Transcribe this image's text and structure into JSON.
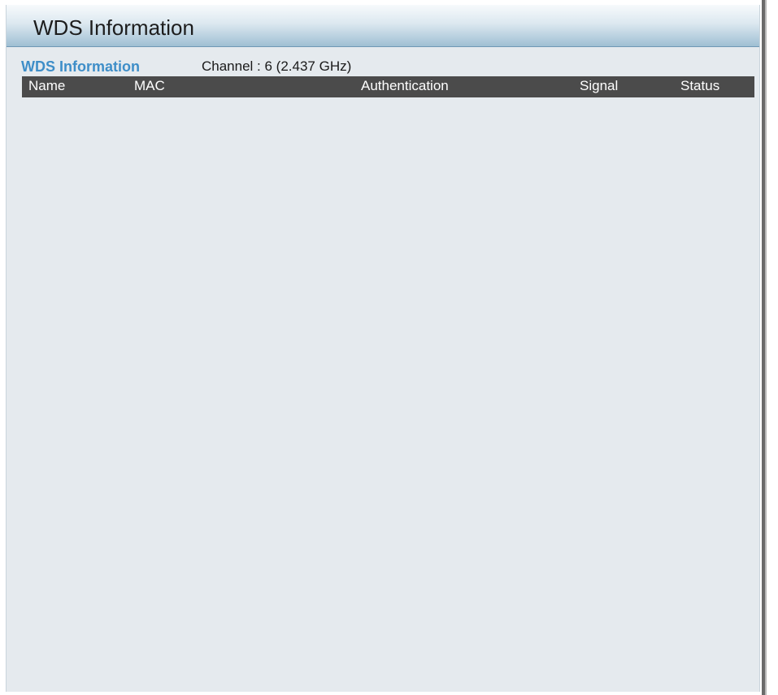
{
  "panel": {
    "title": "WDS Information"
  },
  "section": {
    "label": "WDS Information",
    "channel": "Channel : 6 (2.437 GHz)"
  },
  "table": {
    "columns": [
      "Name",
      "MAC",
      "Authentication",
      "Signal",
      "Status"
    ],
    "rows": []
  },
  "colors": {
    "panel_bg": "#e5eaee",
    "section_label": "#3e8ec8",
    "table_header_bg": "#4b4b4b"
  }
}
